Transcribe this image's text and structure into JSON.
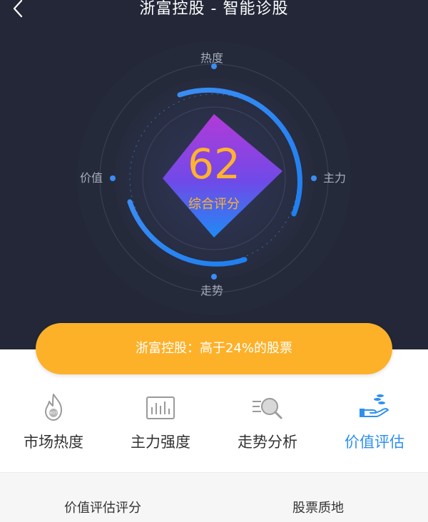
{
  "header": {
    "title": "浙富控股 - 智能诊股"
  },
  "radar": {
    "axes": {
      "top": "热度",
      "right": "主力",
      "bottom": "走势",
      "left": "价值"
    },
    "score": "62",
    "score_label": "综合评分"
  },
  "banner": {
    "text": "浙富控股：高于24%的股票"
  },
  "tabs": [
    {
      "label": "市场热度",
      "icon": "fire-hot-icon",
      "active": false
    },
    {
      "label": "主力强度",
      "icon": "bar-chart-icon",
      "active": false
    },
    {
      "label": "走势分析",
      "icon": "magnifier-list-icon",
      "active": false
    },
    {
      "label": "价值评估",
      "icon": "hand-coins-icon",
      "active": true
    }
  ],
  "sub_header": {
    "left": "价值评估评分",
    "right": "股票质地"
  },
  "colors": {
    "hero_bg": "#232737",
    "accent_blue": "#2f8ff0",
    "score_orange": "#ffb32c",
    "banner": "#fdb129"
  }
}
